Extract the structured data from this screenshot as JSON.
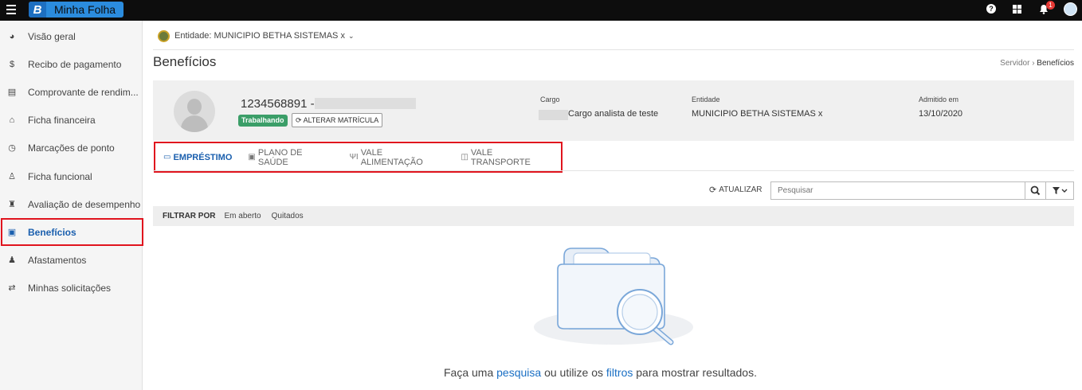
{
  "app": {
    "logo_letter": "B",
    "name": "Minha Folha",
    "notifications_count": "1"
  },
  "sidebar": {
    "items": [
      {
        "label": "Visão geral",
        "icon": "pie-chart-icon"
      },
      {
        "label": "Recibo de pagamento",
        "icon": "dollar-icon"
      },
      {
        "label": "Comprovante de rendim...",
        "icon": "document-icon"
      },
      {
        "label": "Ficha financeira",
        "icon": "bank-icon"
      },
      {
        "label": "Marcações de ponto",
        "icon": "clock-icon"
      },
      {
        "label": "Ficha funcional",
        "icon": "user-icon"
      },
      {
        "label": "Avaliação de desempenho",
        "icon": "trophy-icon"
      },
      {
        "label": "Benefícios",
        "icon": "gift-icon",
        "active": true
      },
      {
        "label": "Afastamentos",
        "icon": "user-times-icon"
      },
      {
        "label": "Minhas solicitações",
        "icon": "exchange-icon"
      }
    ]
  },
  "entity": {
    "label": "Entidade: MUNICIPIO BETHA SISTEMAS x"
  },
  "page": {
    "title": "Benefícios",
    "breadcrumb_parent": "Servidor",
    "breadcrumb_current": "Benefícios"
  },
  "profile": {
    "matricula": "1234568891 -",
    "status": "Trabalhando",
    "alter_button": "ALTERAR MATRÍCULA",
    "cargo_label": "Cargo",
    "cargo_value": "Cargo analista de teste",
    "entidade_label": "Entidade",
    "entidade_value": "MUNICIPIO BETHA SISTEMAS x",
    "admitido_label": "Admitido em",
    "admitido_value": "13/10/2020"
  },
  "tabs": [
    {
      "label": "EMPRÉSTIMO",
      "icon": "money-icon",
      "active": true
    },
    {
      "label": "PLANO DE SAÚDE",
      "icon": "medkit-icon"
    },
    {
      "label": "VALE ALIMENTAÇÃO",
      "icon": "cutlery-icon"
    },
    {
      "label": "VALE TRANSPORTE",
      "icon": "bus-icon"
    }
  ],
  "toolbar": {
    "refresh_label": "ATUALIZAR",
    "search_placeholder": "Pesquisar"
  },
  "filter": {
    "label": "FILTRAR POR",
    "options": [
      "Em aberto",
      "Quitados"
    ]
  },
  "empty": {
    "text_1": "Faça uma ",
    "link_1": "pesquisa",
    "text_2": " ou utilize os ",
    "link_2": "filtros",
    "text_3": " para mostrar resultados."
  }
}
